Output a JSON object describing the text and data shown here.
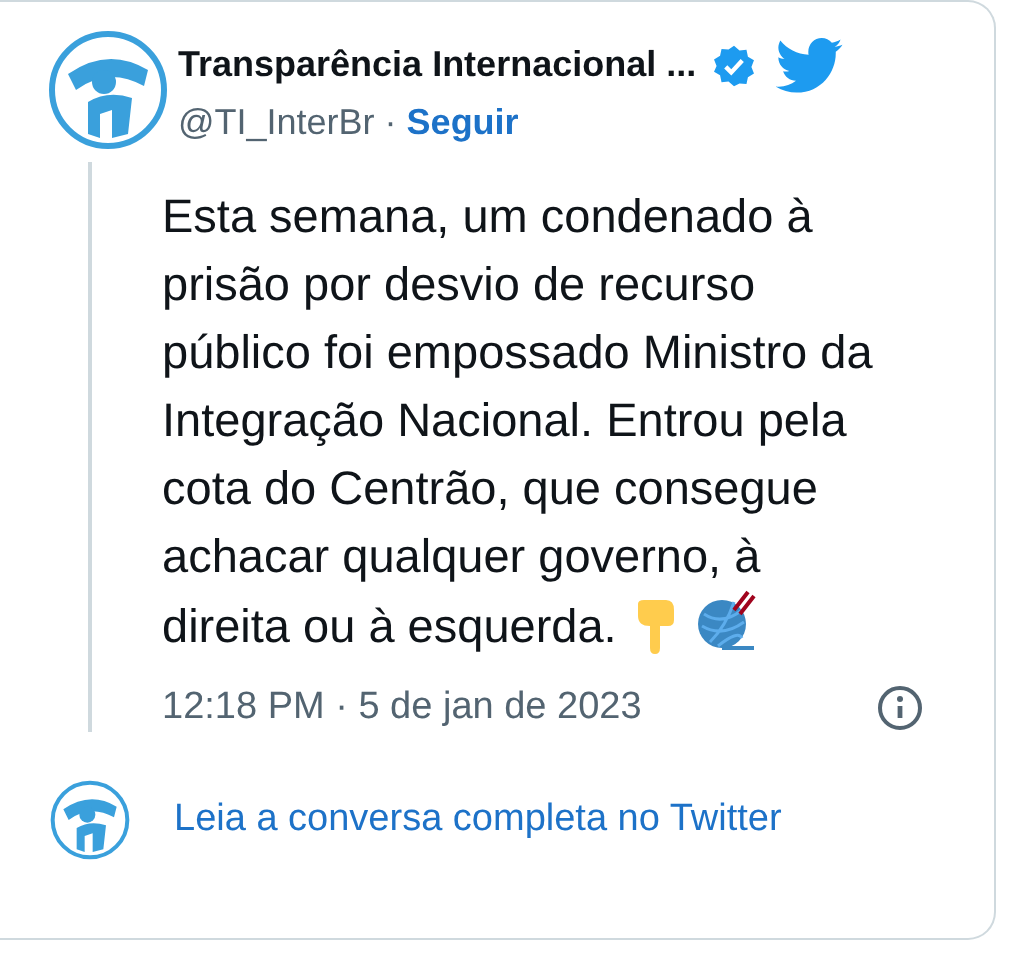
{
  "author": {
    "name": "Transparência Internacional ...",
    "verified": true,
    "handle": "@TI_InterBr",
    "separator": "·",
    "follow": "Seguir"
  },
  "tweet": {
    "text": "Esta semana, um condenado à prisão por desvio de recurso público foi empossado Ministro da Integração Nacional. Entrou pela cota do Centrão, que consegue achacar qualquer governo, à direita ou à esquerda.",
    "timestamp": "12:18 PM · 5 de jan de 2023"
  },
  "footer": {
    "link": "Leia a conversa completa no Twitter"
  }
}
